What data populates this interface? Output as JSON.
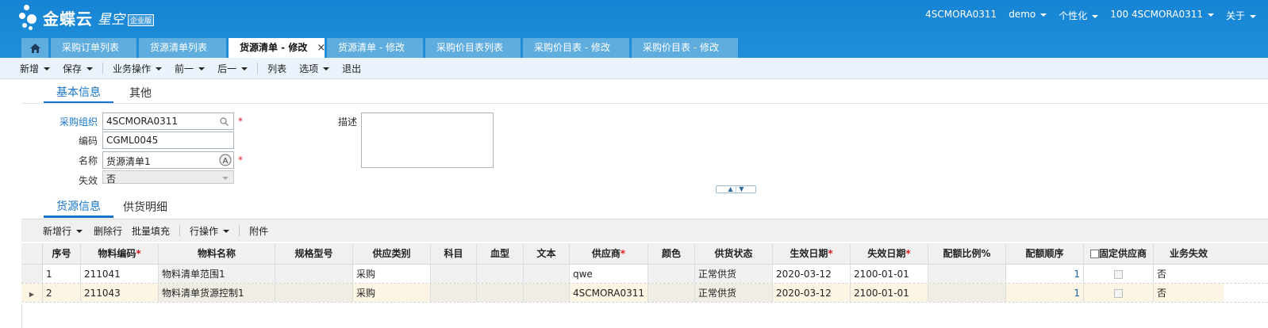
{
  "header": {
    "logo_text": "金蝶云",
    "logo_sub": "星空",
    "logo_badge": "企业版",
    "user_org": "4SCMORA0311",
    "user_name": "demo",
    "personalize": "个性化",
    "org_switch": "100 4SCMORA0311",
    "about": "关于"
  },
  "tabs": [
    {
      "label": "采购订单列表"
    },
    {
      "label": "货源清单列表"
    },
    {
      "label": "货源清单 - 修改",
      "close": "×"
    },
    {
      "label": "货源清单 - 修改"
    },
    {
      "label": "采购价目表列表"
    },
    {
      "label": "采购价目表 - 修改"
    },
    {
      "label": "采购价目表 - 修改"
    }
  ],
  "toolbar": {
    "new": "新增",
    "save": "保存",
    "business_ops": "业务操作",
    "prev": "前一",
    "next": "后一",
    "list": "列表",
    "options": "选项",
    "exit": "退出"
  },
  "form_tabs": {
    "basic": "基本信息",
    "other": "其他"
  },
  "form": {
    "purchase_org_label": "采购组织",
    "purchase_org_value": "4SCMORA0311",
    "code_label": "编码",
    "code_value": "CGML0045",
    "name_label": "名称",
    "name_value": "货源清单1",
    "invalid_label": "失效",
    "invalid_value": "否",
    "desc_label": "描述",
    "desc_value": "",
    "required_mark": "*"
  },
  "detail_tabs": {
    "source": "货源信息",
    "supply": "供货明细"
  },
  "grid_toolbar": {
    "add_row": "新增行",
    "delete_row": "删除行",
    "batch_fill": "批量填充",
    "row_ops": "行操作",
    "attachment": "附件"
  },
  "grid": {
    "columns": [
      "序号",
      "物料编码",
      "物料名称",
      "规格型号",
      "供应类别",
      "科目",
      "血型",
      "文本",
      "供应商",
      "颜色",
      "供货状态",
      "生效日期",
      "失效日期",
      "配额比例%",
      "配额顺序",
      "固定供应商",
      "业务失效"
    ],
    "rows": [
      [
        "1",
        "211041",
        "物料清单范围1",
        "",
        "采购",
        "",
        "",
        "",
        "qwe",
        "",
        "正常供货",
        "2020-03-12",
        "2100-01-01",
        "",
        "1",
        "",
        "否"
      ],
      [
        "2",
        "211043",
        "物料清单货源控制1",
        "",
        "采购",
        "",
        "",
        "",
        "4SCMORA0311",
        "",
        "正常供货",
        "2020-03-12",
        "2100-01-01",
        "",
        "1",
        "",
        "否"
      ]
    ]
  },
  "colors": {
    "header_blue": "#1684d4",
    "accent": "#1776c9",
    "required": "#e02020"
  }
}
